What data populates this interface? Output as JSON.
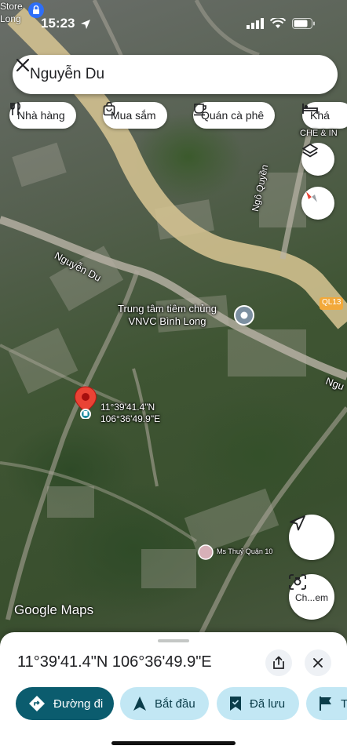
{
  "status_bar": {
    "time": "15:23",
    "store_label_line1": "Store",
    "store_label_line2": "Long"
  },
  "search": {
    "query": "Nguyễn Du",
    "close_icon": "close-icon"
  },
  "chips": [
    {
      "label": "Nhà hàng",
      "icon": "restaurant-icon"
    },
    {
      "label": "Mua sắm",
      "icon": "shopping-bag-icon"
    },
    {
      "label": "Quán cà phê",
      "icon": "coffee-icon"
    },
    {
      "label": "Khá",
      "icon": "bed-icon"
    }
  ],
  "map": {
    "labels": {
      "road_nguyen_du": "Nguyễn Du",
      "road_ngo_quyen": "Ngô Quyền",
      "road_ql13": "QL13",
      "road_ngu": "Ngu",
      "che_label": "CHE & IN",
      "poi_line1": "Trung tâm tiêm chủng",
      "poi_line2": "VNVC Bình Long",
      "place_small": "Ms Thuỷ Quận 10"
    },
    "pin": {
      "lat": "11°39'41.4\"N",
      "lng": "106°36'49.9\"E"
    },
    "attribution": "Google Maps",
    "controls": {
      "layers_icon": "layers-icon",
      "compass_icon": "compass-icon",
      "location_icon": "my-location-icon",
      "search_image_label": "Ch...em",
      "search_image_icon": "camera-search-icon"
    }
  },
  "sheet": {
    "title": "11°39'41.4\"N 106°36'49.9\"E",
    "share_icon": "share-icon",
    "close_icon": "close-icon",
    "actions": [
      {
        "label": "Đường đi",
        "icon": "directions-icon"
      },
      {
        "label": "Bắt đầu",
        "icon": "navigation-arrow-icon"
      },
      {
        "label": "Đã lưu",
        "icon": "bookmark-icon"
      },
      {
        "label": "T",
        "icon": "flag-icon"
      }
    ]
  },
  "colors": {
    "primary": "#0b57d0",
    "teal_action": "#0b5c6e",
    "light_action": "#c2e7f4",
    "pin_red": "#ea4335"
  }
}
